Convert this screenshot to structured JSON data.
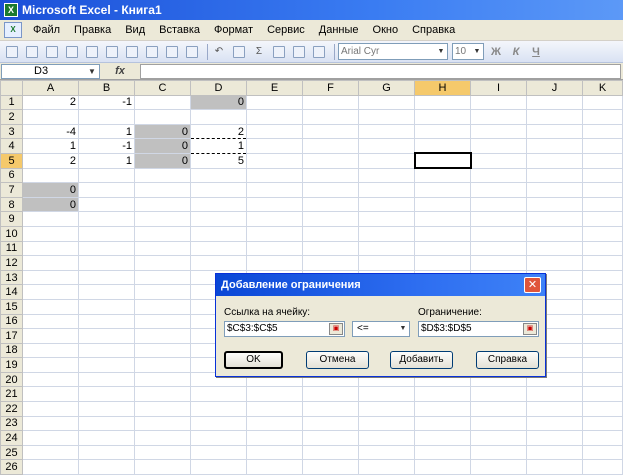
{
  "window": {
    "title": "Microsoft Excel - Книга1",
    "app_icon": "excel-icon"
  },
  "menu": [
    "Файл",
    "Правка",
    "Вид",
    "Вставка",
    "Формат",
    "Сервис",
    "Данные",
    "Окно",
    "Справка"
  ],
  "toolbar": {
    "font": "Arial Cyr",
    "size": "10",
    "bold": "Ж",
    "italic": "К",
    "underline": "Ч",
    "sigma": "Σ"
  },
  "formula_bar": {
    "name_box": "D3",
    "fx": "fx",
    "formula": ""
  },
  "sheet": {
    "columns": [
      "A",
      "B",
      "C",
      "D",
      "E",
      "F",
      "G",
      "H",
      "I",
      "J",
      "K"
    ],
    "rows": [
      "1",
      "2",
      "3",
      "4",
      "5",
      "6",
      "7",
      "8",
      "9",
      "10",
      "11",
      "12",
      "13",
      "14",
      "15",
      "16",
      "17",
      "18",
      "19",
      "20",
      "21",
      "22",
      "23",
      "24",
      "25",
      "26"
    ],
    "cells": {
      "A1": "2",
      "B1": "-1",
      "D1": "0",
      "A3": "-4",
      "B3": "1",
      "C3": "0",
      "D3": "2",
      "A4": "1",
      "B4": "-1",
      "C4": "0",
      "D4": "1",
      "A5": "2",
      "B5": "1",
      "C5": "0",
      "D5": "5",
      "A7": "0",
      "A8": "0"
    },
    "shaded": [
      "D1",
      "C3",
      "C4",
      "C5",
      "A7",
      "A8"
    ],
    "marching": [
      "D3",
      "D4",
      "D5"
    ],
    "selected": "H5"
  },
  "dialog": {
    "title": "Добавление ограничения",
    "cell_ref_label": "Ссылка на ячейку:",
    "cell_ref_value": "$C$3:$C$5",
    "operator": "<=",
    "constraint_label": "Ограничение:",
    "constraint_value": "$D$3:$D$5",
    "ok": "OK",
    "cancel": "Отмена",
    "add": "Добавить",
    "help": "Справка"
  }
}
